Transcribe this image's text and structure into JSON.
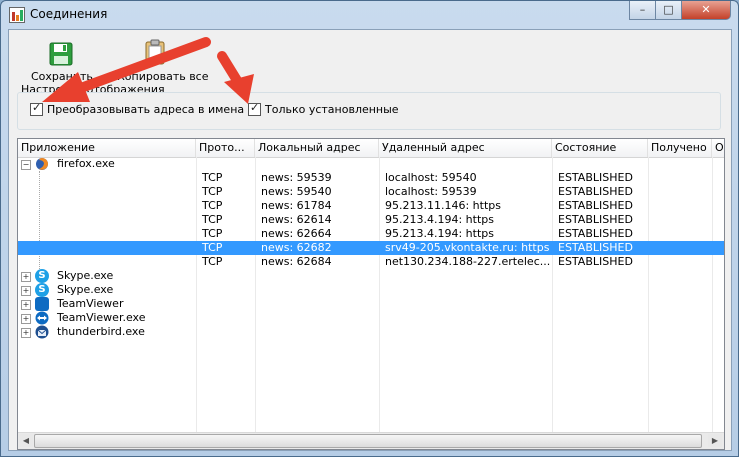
{
  "window": {
    "title": "Соединения",
    "minimize": "–",
    "maximize": "□",
    "close": "✕"
  },
  "toolbar": {
    "save_label": "Сохранить",
    "copy_all_label": "Копировать все"
  },
  "settings": {
    "tab_label": "Настройки отображения",
    "convert_addresses": {
      "label": "Преобразовывать адреса в имена",
      "checked": true
    },
    "only_established": {
      "label": "Только установленные",
      "checked": true
    }
  },
  "grid": {
    "columns": [
      "Приложение",
      "Прото...",
      "Локальный адрес",
      "Удаленный адрес",
      "Состояние",
      "Получено",
      "О"
    ],
    "processes": [
      {
        "name": "firefox.exe",
        "icon": "firefox-icon",
        "expanded": true
      },
      {
        "name": "Skype.exe",
        "icon": "skype-icon",
        "expanded": false
      },
      {
        "name": "Skype.exe",
        "icon": "skype-icon",
        "expanded": false
      },
      {
        "name": "TeamViewer",
        "icon": "teamviewer-icon",
        "expanded": false
      },
      {
        "name": "TeamViewer.exe",
        "icon": "teamviewer-icon",
        "expanded": false
      },
      {
        "name": "thunderbird.exe",
        "icon": "thunderbird-icon",
        "expanded": false
      }
    ],
    "connections": [
      {
        "protocol": "TCP",
        "local": "news: 59539",
        "remote": "localhost: 59540",
        "state": "ESTABLISHED",
        "selected": false
      },
      {
        "protocol": "TCP",
        "local": "news: 59540",
        "remote": "localhost: 59539",
        "state": "ESTABLISHED",
        "selected": false
      },
      {
        "protocol": "TCP",
        "local": "news: 61784",
        "remote": "95.213.11.146: https",
        "state": "ESTABLISHED",
        "selected": false
      },
      {
        "protocol": "TCP",
        "local": "news: 62614",
        "remote": "95.213.4.194: https",
        "state": "ESTABLISHED",
        "selected": false
      },
      {
        "protocol": "TCP",
        "local": "news: 62664",
        "remote": "95.213.4.194: https",
        "state": "ESTABLISHED",
        "selected": false
      },
      {
        "protocol": "TCP",
        "local": "news: 62682",
        "remote": "srv49-205.vkontakte.ru: https",
        "state": "ESTABLISHED",
        "selected": true
      },
      {
        "protocol": "TCP",
        "local": "news: 62684",
        "remote": "net130.234.188-227.ertelec...",
        "state": "ESTABLISHED",
        "selected": false
      }
    ]
  },
  "colors": {
    "selection": "#3399ff",
    "annotation_arrow": "#e8402e"
  }
}
